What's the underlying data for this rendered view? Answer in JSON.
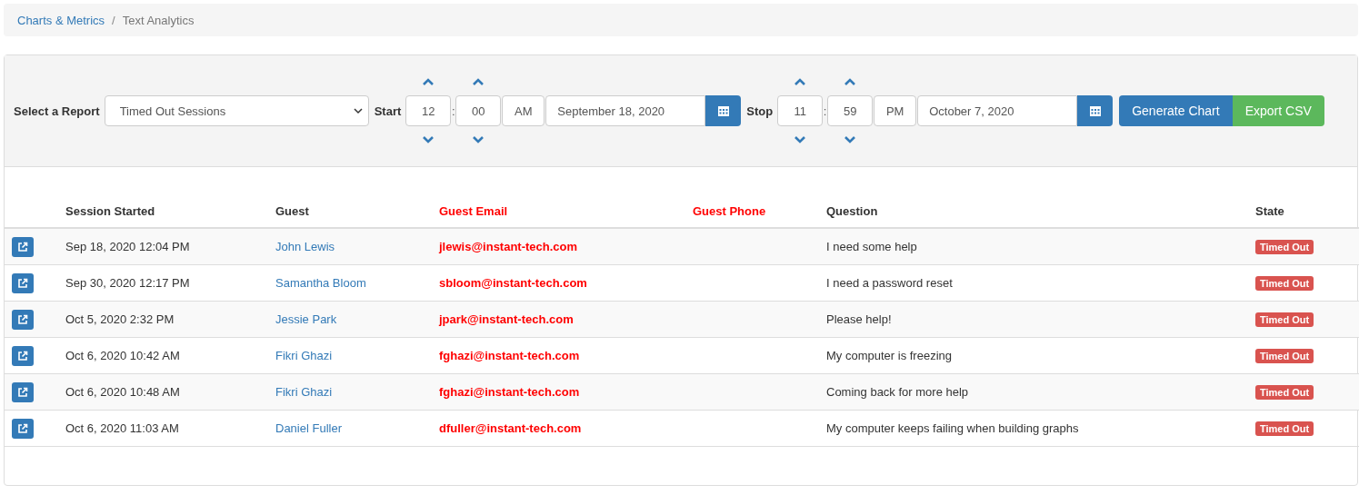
{
  "breadcrumb_separator": "/",
  "breadcrumb": [
    {
      "label": "Charts & Metrics",
      "link": true
    },
    {
      "label": "Text Analytics",
      "link": false
    }
  ],
  "toolbar": {
    "report_label": "Select a Report",
    "report": "Timed Out Sessions",
    "start": {
      "label": "Start",
      "hour": "12",
      "minute": "00",
      "separator": ":",
      "period": "AM",
      "date": "September 18, 2020"
    },
    "stop": {
      "label": "Stop",
      "hour": "11",
      "minute": "59",
      "separator": ":",
      "period": "PM",
      "date": "October 7, 2020"
    },
    "buttons": [
      {
        "label": "Generate Chart",
        "kind": "primary"
      },
      {
        "label": "Export CSV",
        "kind": "success"
      }
    ]
  },
  "table": {
    "columns": [
      {
        "label": "Session Started",
        "highlight": false
      },
      {
        "label": "Guest",
        "highlight": false
      },
      {
        "label": "Guest Email",
        "highlight": true
      },
      {
        "label": "Guest Phone",
        "highlight": true
      },
      {
        "label": "Question",
        "highlight": false
      },
      {
        "label": "State",
        "highlight": false
      }
    ],
    "rows": [
      {
        "started": "Sep 18, 2020 12:04 PM",
        "guest": "John Lewis",
        "email": "jlewis@instant-tech.com",
        "question": "I need some help",
        "state": "Timed Out"
      },
      {
        "started": "Sep 30, 2020 12:17 PM",
        "guest": "Samantha Bloom",
        "email": "sbloom@instant-tech.com",
        "question": "I need a password reset",
        "state": "Timed Out"
      },
      {
        "started": "Oct 5, 2020 2:32 PM",
        "guest": "Jessie Park",
        "email": "jpark@instant-tech.com",
        "question": "Please help!",
        "state": "Timed Out"
      },
      {
        "started": "Oct 6, 2020 10:42 AM",
        "guest": "Fikri Ghazi",
        "email": "fghazi@instant-tech.com",
        "question": "My computer is freezing",
        "state": "Timed Out"
      },
      {
        "started": "Oct 6, 2020 10:48 AM",
        "guest": "Fikri Ghazi",
        "email": "fghazi@instant-tech.com",
        "question": "Coming back for more help",
        "state": "Timed Out"
      },
      {
        "started": "Oct 6, 2020 11:03 AM",
        "guest": "Daniel Fuller",
        "email": "dfuller@instant-tech.com",
        "question": "My computer keeps failing when building graphs",
        "state": "Timed Out"
      }
    ]
  }
}
